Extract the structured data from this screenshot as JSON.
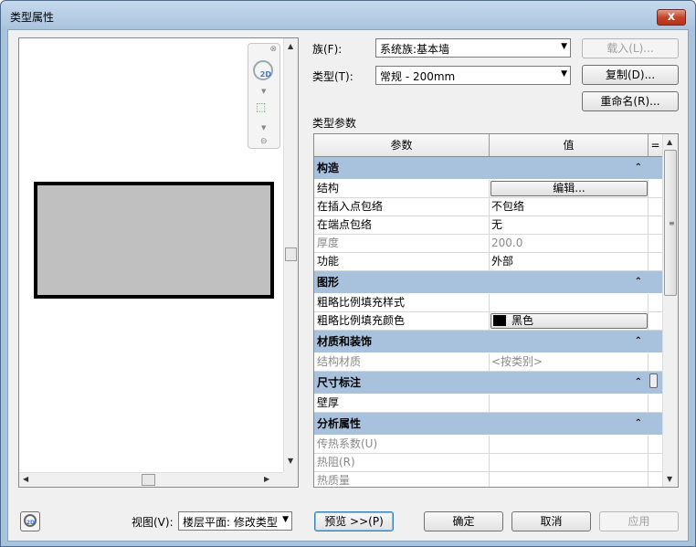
{
  "window": {
    "title": "类型属性",
    "close_glyph": "x"
  },
  "form": {
    "family_label": "族(F):",
    "family_value": "系统族:基本墙",
    "type_label": "类型(T):",
    "type_value": "常规 - 200mm",
    "load_button": "载入(L)...",
    "duplicate_button": "复制(D)...",
    "rename_button": "重命名(R)...",
    "section_title": "类型参数"
  },
  "grid": {
    "col_param": "参数",
    "col_value": "值",
    "col_extra": "=",
    "groups": [
      {
        "name": "构造",
        "rows": [
          {
            "param": "结构",
            "value": "编辑...",
            "kind": "button",
            "dim": false
          },
          {
            "param": "在插入点包络",
            "value": "不包络",
            "kind": "text",
            "dim": false
          },
          {
            "param": "在端点包络",
            "value": "无",
            "kind": "text",
            "dim": false
          },
          {
            "param": "厚度",
            "value": "200.0",
            "kind": "text",
            "dim": true
          },
          {
            "param": "功能",
            "value": "外部",
            "kind": "text",
            "dim": false
          }
        ]
      },
      {
        "name": "图形",
        "rows": [
          {
            "param": "粗略比例填充样式",
            "value": "",
            "kind": "text",
            "dim": false
          },
          {
            "param": "粗略比例填充颜色",
            "value": "黑色",
            "kind": "swatch",
            "dim": false
          }
        ]
      },
      {
        "name": "材质和装饰",
        "rows": [
          {
            "param": "结构材质",
            "value": "<按类别>",
            "kind": "text",
            "dim": true
          }
        ]
      },
      {
        "name": "尺寸标注",
        "rows": [
          {
            "param": "壁厚",
            "value": "",
            "kind": "text",
            "dim": false
          }
        ]
      },
      {
        "name": "分析属性",
        "rows": [
          {
            "param": "传热系数(U)",
            "value": "",
            "kind": "text",
            "dim": true
          },
          {
            "param": "热阻(R)",
            "value": "",
            "kind": "text",
            "dim": true
          },
          {
            "param": "热质量",
            "value": "",
            "kind": "text",
            "dim": true
          }
        ]
      }
    ]
  },
  "bottom": {
    "view_label": "视图(V):",
    "view_value": "楼层平面: 修改类型",
    "preview_button": "预览 >>(P)",
    "ok_button": "确定",
    "cancel_button": "取消",
    "apply_button": "应用"
  },
  "colors": {
    "group_header": "#a8c1dd",
    "title_bar": "#a9c3dd",
    "wall_fill": "#c0c0c0"
  },
  "icons": {
    "close": "close-icon",
    "nav_2d": "view-2d-icon",
    "zoom": "zoom-region-icon"
  }
}
